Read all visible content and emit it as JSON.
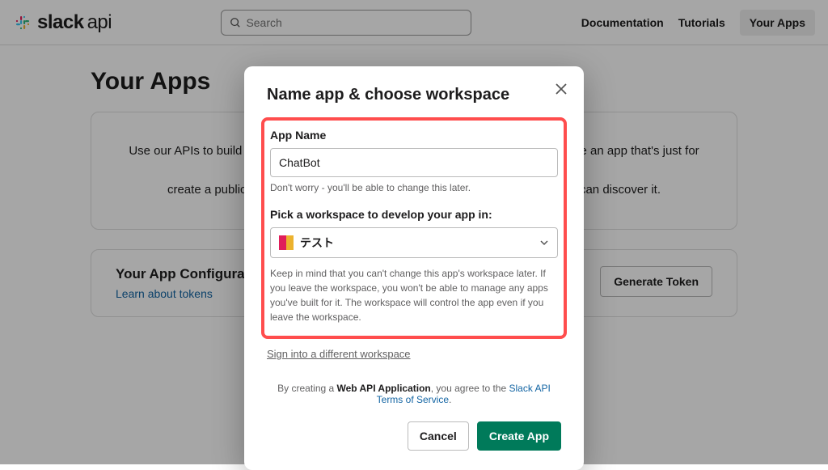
{
  "header": {
    "logo_bold": "slack",
    "logo_light": "api",
    "search_placeholder": "Search",
    "nav": {
      "docs": "Documentation",
      "tutorials": "Tutorials",
      "apps": "Your Apps"
    }
  },
  "main": {
    "title": "Your Apps",
    "intro_line1": "Use our APIs to build an app that makes people's working lives better. You can create an app that's just for your workspace or",
    "intro_line2": "create a public Slack App to list in the App Directory, where anyone on Slack can discover it.",
    "config_title": "Your App Configuration Tokens",
    "config_link": "Learn about tokens",
    "gen_token": "Generate Token"
  },
  "modal": {
    "title": "Name app & choose workspace",
    "app_name_label": "App Name",
    "app_name_value": "ChatBot",
    "app_name_helper": "Don't worry - you'll be able to change this later.",
    "workspace_label": "Pick a workspace to develop your app in:",
    "workspace_name": "テスト",
    "workspace_warn": "Keep in mind that you can't change this app's workspace later. If you leave the workspace, you won't be able to manage any apps you've built for it. The workspace will control the app even if you leave the workspace.",
    "sign_link": "Sign into a different workspace",
    "tos_prefix": "By creating a ",
    "tos_bold": "Web API Application",
    "tos_mid": ", you agree to the ",
    "tos_link": "Slack API Terms of Service",
    "tos_suffix": ".",
    "cancel": "Cancel",
    "create": "Create App"
  }
}
